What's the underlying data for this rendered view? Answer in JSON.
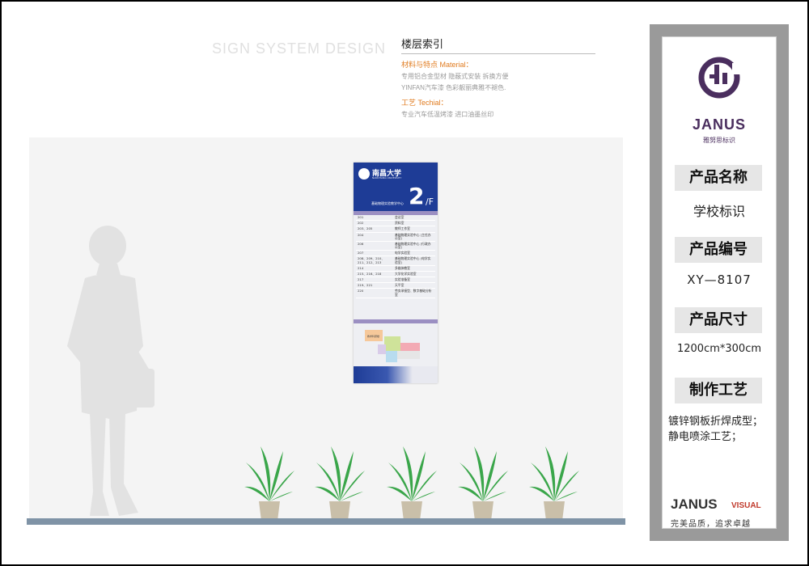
{
  "watermark": "SIGN SYSTEM DESIGN",
  "info": {
    "title": "楼层索引",
    "material_heading": "材料与特点 Material：",
    "material_line1": "专用铝合金型材          隐蔽式安装          拆换方便",
    "material_line2": "YINFAN汽车漆    色彩靓丽典雅不褪色.",
    "craft_heading": "工艺 Techial：",
    "craft_line": "专业汽车低温烤漆          进口油墨丝印"
  },
  "sign": {
    "university": "南昌大学",
    "university_en": "NANCHANG UNIVERSITY",
    "center": "基础物理实验教学中心",
    "floor_number": "2",
    "floor_suffix": "/F",
    "rows": [
      {
        "room": "201",
        "name": "会议室"
      },
      {
        "room": "202",
        "name": "资料室"
      },
      {
        "room": "203、205",
        "name": "教师工作室"
      },
      {
        "room": "204",
        "name": "基础物理实验中心 (主任办公室)"
      },
      {
        "room": "206",
        "name": "基础物理实验中心 (行政办公室)"
      },
      {
        "room": "207",
        "name": "电学实验室"
      },
      {
        "room": "208、209、210、211、212、213",
        "name": "基础物理实验中心 (电学实验室)"
      },
      {
        "room": "214",
        "name": "多媒体教室"
      },
      {
        "room": "215、216、218",
        "name": "大学化学实验室"
      },
      {
        "room": "217",
        "name": "实验准备室"
      },
      {
        "room": "219、221",
        "name": "天平室"
      },
      {
        "room": "220",
        "name": "劳务承接型、数字基础分析室"
      }
    ],
    "map_label": "教学科研楼"
  },
  "panel": {
    "brand": "JANUS",
    "brand_sub": "雅努思标识",
    "name_label": "产品名称",
    "name_value": "学校标识",
    "code_label": "产品编号",
    "code_value": "XY—8107",
    "size_label": "产品尺寸",
    "size_value": "1200cm*300cm",
    "craft_label": "制作工艺",
    "craft_value": "镀锌钢板折焊成型；静电喷涂工艺；",
    "footer_brand": "JANUS",
    "footer_visual": "VISUAL",
    "footer_slogan": "完美品质，追求卓越"
  },
  "colors": {
    "sign_blue": "#1e3c96",
    "brand_purple": "#4a2e5e",
    "accent_orange": "#e07b1f",
    "plant_green": "#3aa64a"
  }
}
